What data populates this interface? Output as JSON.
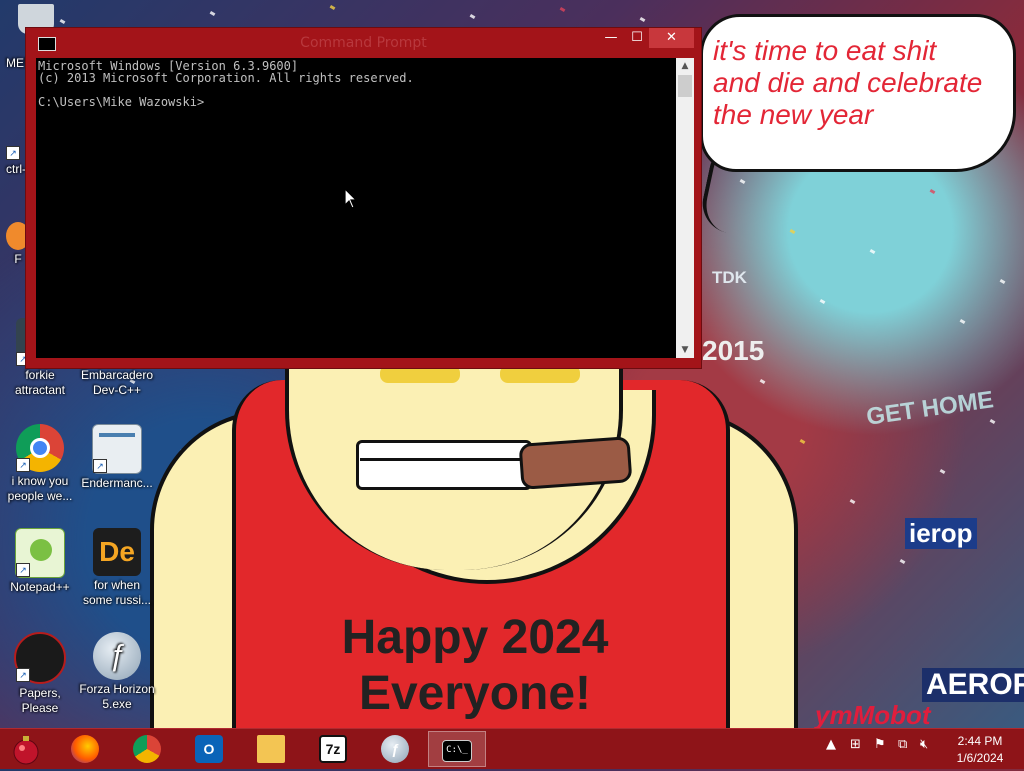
{
  "wallpaper": {
    "bubble_text": "it's time to eat shit\nand die and celebrate\nthe new year",
    "shirt_text": "Happy 2024\nEveryone!",
    "signature": "ymMobot"
  },
  "desktop_icons": [
    {
      "label": "ctrl-"
    },
    {
      "label": "F"
    },
    {
      "label": "forkie\nattractant"
    },
    {
      "label": "Embarcadero\nDev-C++"
    },
    {
      "label": "i know you\npeople we..."
    },
    {
      "label": "Endermanc..."
    },
    {
      "label": "Notepad++"
    },
    {
      "label": "for when\nsome russi..."
    },
    {
      "label": "Papers, Please"
    },
    {
      "label": "Forza Horizon\n5.exe"
    },
    {
      "label": "MEM"
    }
  ],
  "cmd_window": {
    "title": "Command Prompt",
    "console_text": "Microsoft Windows [Version 6.3.9600]\n(c) 2013 Microsoft Corporation. All rights reserved.\n\nC:\\Users\\Mike Wazowski>",
    "minimize": "—",
    "maximize": "☐",
    "close": "✕"
  },
  "taskbar": {
    "apps": [
      {
        "name": "Start"
      },
      {
        "name": "Firefox"
      },
      {
        "name": "Chrome"
      },
      {
        "name": "Outlook",
        "glyph": "O"
      },
      {
        "name": "File Explorer"
      },
      {
        "name": "7-Zip",
        "glyph": "7z"
      },
      {
        "name": "Flash Player"
      },
      {
        "name": "Command Prompt",
        "glyph": "C:\\_"
      }
    ],
    "clock": {
      "time": "2:44 PM",
      "date": "1/6/2024"
    }
  },
  "billboards": {
    "tdk": "TDK",
    "year_sign": "2015",
    "get_home": "GET HOME",
    "aerop": "ierop",
    "aeroflo": "AEROFS"
  }
}
